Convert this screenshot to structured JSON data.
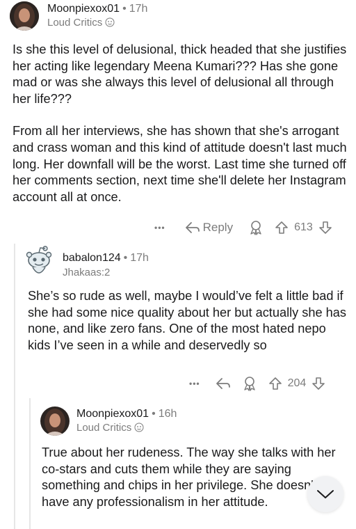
{
  "comments": [
    {
      "username": "Moonpiexox01",
      "time": "17h",
      "flair": "Loud Critics",
      "paragraphs": [
        "Is she this level of delusional, thick headed that she justifies her acting like legendary Meena Kumari??? Has she gone mad or was she always this level of delusional all through her life???",
        "From all her interviews, she has shown that she's arrogant and crass woman and this kind of attitude doesn't last much long. Her downfall will be the worst. Last time she turned off her comments section, next time she'll delete her Instagram account all at once."
      ],
      "more_label": "•••",
      "reply_label": "Reply",
      "votes": "613"
    },
    {
      "username": "babalon124",
      "time": "17h",
      "flair": "Jhakaas:2",
      "paragraphs": [
        "She’s so rude as well, maybe I would’ve felt a little bad if she had some nice quality about her but actually she has none, and like zero fans. One of the most hated nepo kids I’ve seen in a while and deservedly so"
      ],
      "more_label": "•••",
      "votes": "204"
    },
    {
      "username": "Moonpiexox01",
      "time": "16h",
      "flair": "Loud Critics",
      "paragraphs": [
        "True about her rudeness. The way she talks with her co-stars and cuts them while they are saying something and chips in her privilege. She doesn't have any professionalism in her attitude."
      ]
    }
  ],
  "separator": "•",
  "colors": {
    "text": "#1a1a1b",
    "meta": "#7c7c7c",
    "thread_line": "#e6e6e6"
  },
  "icons": [
    "avatar",
    "flair-emoji-icon",
    "reply-arrow-icon",
    "award-icon",
    "upvote-icon",
    "downvote-icon",
    "chevron-down-icon"
  ]
}
